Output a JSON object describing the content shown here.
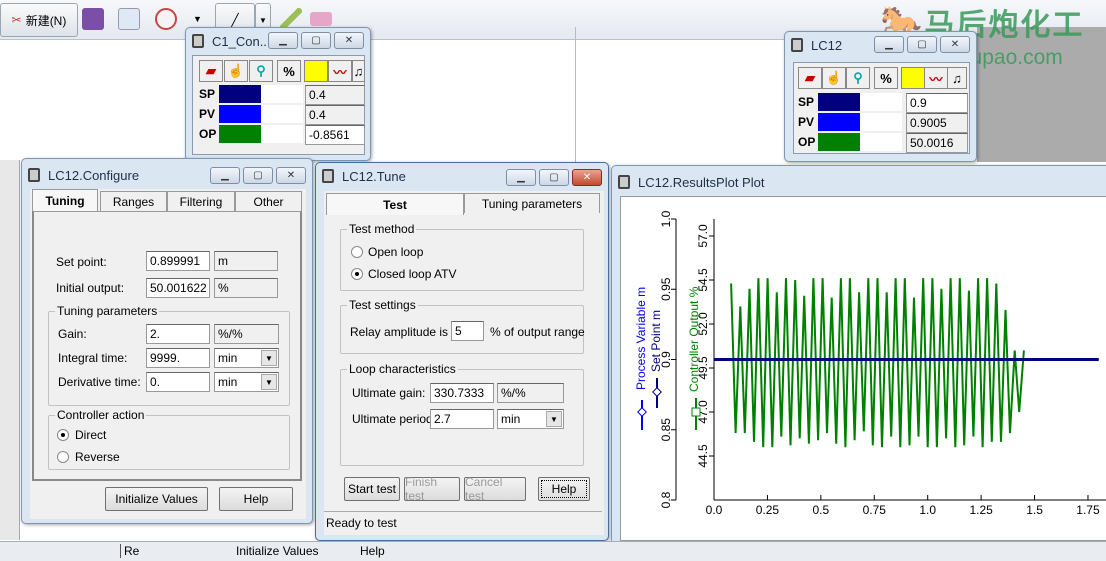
{
  "app_toolbar": {
    "new_label": "新建(N)",
    "icons": [
      "scissors-icon",
      "save-icon",
      "copy-icon",
      "email-icon",
      "pen-icon",
      "highlighter-icon",
      "eraser-icon"
    ]
  },
  "watermark": {
    "chinese": "马后炮化工",
    "url": "Mahoupao.com"
  },
  "faceplate_c1": {
    "title": "C1_Con...",
    "rows": [
      {
        "label": "SP",
        "value": "0.4",
        "color": "#000080",
        "fill": 0.5
      },
      {
        "label": "PV",
        "value": "0.4",
        "color": "#0000ff",
        "fill": 0.5
      },
      {
        "label": "OP",
        "value": "-0.8561",
        "color": "#008000",
        "fill": 0.5
      }
    ],
    "tool_percent": "%"
  },
  "faceplate_lc12": {
    "title": "LC12",
    "rows": [
      {
        "label": "SP",
        "value": "0.9",
        "color": "#000080",
        "fill": 0.5
      },
      {
        "label": "PV",
        "value": "0.9005",
        "color": "#0000ff",
        "fill": 0.5
      },
      {
        "label": "OP",
        "value": "50.0016",
        "color": "#008000",
        "fill": 0.5
      }
    ],
    "tool_percent": "%"
  },
  "configure": {
    "title": "LC12.Configure",
    "tabs": [
      "Tuning",
      "Ranges",
      "Filtering",
      "Other"
    ],
    "set_point": {
      "label": "Set point:",
      "value": "0.899991",
      "unit": "m"
    },
    "initial_output": {
      "label": "Initial output:",
      "value": "50.001622",
      "unit": "%"
    },
    "tuning_group": "Tuning parameters",
    "gain": {
      "label": "Gain:",
      "value": "2.",
      "unit": "%/%"
    },
    "integral": {
      "label": "Integral time:",
      "value": "9999.",
      "unit": "min"
    },
    "derivative": {
      "label": "Derivative time:",
      "value": "0.",
      "unit": "min"
    },
    "action_group": "Controller action",
    "direct": "Direct",
    "reverse": "Reverse",
    "init_button": "Initialize Values",
    "help_button": "Help"
  },
  "tune": {
    "title": "LC12.Tune",
    "tabs": [
      "Test",
      "Tuning parameters"
    ],
    "method_group": "Test method",
    "open_loop": "Open loop",
    "closed_loop": "Closed loop ATV",
    "settings_group": "Test settings",
    "relay_label": "Relay amplitude is",
    "relay_value": "5",
    "relay_unit": "% of output range",
    "loop_group": "Loop characteristics",
    "ult_gain_label": "Ultimate gain:",
    "ult_gain_value": "330.7333",
    "ult_gain_unit": "%/%",
    "ult_period_label": "Ultimate period:",
    "ult_period_value": "2.7",
    "ult_period_unit": "min",
    "start": "Start test",
    "finish": "Finish test",
    "cancel": "Cancel test",
    "help": "Help",
    "status": "Ready to test"
  },
  "plot_window": {
    "title": "LC12.ResultsPlot Plot"
  },
  "bottom_strip": {
    "items": [
      "Re",
      "Initialize Values",
      "Help"
    ]
  },
  "chart_data": {
    "type": "line",
    "title": "",
    "xlabel": "",
    "xlim": [
      0,
      1.8
    ],
    "xticks": [
      "0.0",
      "0.25",
      "0.5",
      "0.75",
      "1.0",
      "1.25",
      "1.5",
      "1.75"
    ],
    "xtick_values": [
      0,
      0.25,
      0.5,
      0.75,
      1.0,
      1.25,
      1.5,
      1.75
    ],
    "left_axis": {
      "labels": [
        "Process Variable m",
        "Set Point m"
      ],
      "ylim": [
        0.8,
        1.0
      ],
      "ticks": [
        "0.8",
        "0.85",
        "0.9",
        "0.95",
        "1.0"
      ],
      "tick_values": [
        0.8,
        0.85,
        0.9,
        0.95,
        1.0
      ]
    },
    "right_axis": {
      "label": "Controller Output %",
      "ylim": [
        42.5,
        58.0
      ],
      "ticks": [
        "44.5",
        "47.0",
        "49.5",
        "52.0",
        "54.5",
        "57.0"
      ],
      "tick_values": [
        44.5,
        47.0,
        49.5,
        52.0,
        54.5,
        57.0
      ]
    },
    "grid": false,
    "series": [
      {
        "name": "Process Variable m",
        "axis": "left",
        "color": "#0000ff",
        "x": [
          0,
          0.08,
          1.45,
          1.8
        ],
        "y": [
          0.9,
          0.9,
          0.9,
          0.9
        ]
      },
      {
        "name": "Set Point m",
        "axis": "left",
        "color": "#000080",
        "x": [
          0,
          1.8
        ],
        "y": [
          0.9,
          0.9
        ]
      },
      {
        "name": "Controller Output %",
        "axis": "right",
        "color": "#008000",
        "x": [
          0.08,
          0.101,
          0.123,
          0.144,
          0.166,
          0.187,
          0.208,
          0.23,
          0.251,
          0.273,
          0.294,
          0.315,
          0.337,
          0.358,
          0.38,
          0.401,
          0.422,
          0.444,
          0.465,
          0.487,
          0.508,
          0.529,
          0.551,
          0.572,
          0.594,
          0.615,
          0.636,
          0.658,
          0.679,
          0.701,
          0.722,
          0.743,
          0.765,
          0.786,
          0.808,
          0.829,
          0.85,
          0.872,
          0.893,
          0.915,
          0.936,
          0.957,
          0.979,
          1.0,
          1.022,
          1.043,
          1.064,
          1.086,
          1.107,
          1.129,
          1.15,
          1.171,
          1.193,
          1.214,
          1.236,
          1.257,
          1.278,
          1.3,
          1.321,
          1.343,
          1.364,
          1.385,
          1.407,
          1.428,
          1.45
        ],
        "y": [
          54.3,
          45.8,
          53.0,
          45.8,
          54.0,
          45.3,
          54.6,
          45.0,
          54.6,
          45.0,
          53.8,
          45.6,
          54.6,
          45.1,
          54.5,
          45.5,
          53.6,
          45.2,
          54.6,
          45.4,
          54.6,
          45.8,
          53.5,
          45.2,
          54.6,
          45.0,
          54.6,
          45.4,
          53.8,
          45.9,
          54.6,
          45.1,
          54.6,
          45.0,
          53.8,
          45.6,
          54.6,
          45.0,
          54.6,
          45.1,
          53.5,
          45.6,
          54.6,
          45.0,
          54.6,
          45.0,
          54.0,
          45.5,
          54.6,
          45.0,
          54.6,
          45.1,
          53.9,
          45.6,
          54.6,
          45.0,
          54.6,
          45.3,
          54.3,
          45.3,
          52.8,
          45.8,
          50.5,
          47.0,
          50.5
        ]
      }
    ]
  }
}
